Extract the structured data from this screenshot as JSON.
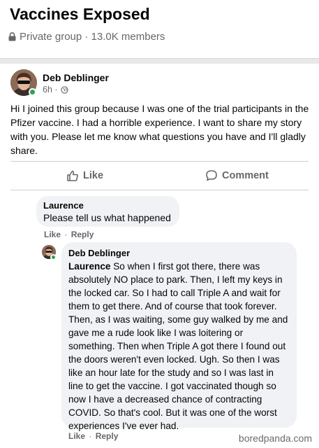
{
  "group": {
    "title": "Vaccines Exposed",
    "meta": "Private group · 13.0K members",
    "privacy_icon": "lock-icon"
  },
  "post": {
    "author": "Deb Deblinger",
    "time": "6h ·",
    "audience_icon": "globe-icon",
    "body": "Hi I joined this group because I was one of the trial participants in the Pfizer vaccine. I had a horrible experience. I want to share my story with you. Please let me know what questions you have and I'll gladly share.",
    "like_label": "Like",
    "comment_label": "Comment"
  },
  "comments": [
    {
      "author": "Laurence",
      "text": "Please tell us what happened",
      "like_label": "Like",
      "separator": "·",
      "reply_label": "Reply"
    },
    {
      "author": "Deb Deblinger",
      "mention": "Laurence",
      "text": " So when I first got there, there was absolutely NO place to park. Then, I left my keys in the locked car. So I had to call Triple A and wait for them to get there. And of course that took forever. Then, as I was waiting, some guy walked by me and gave me a rude look like I was loitering or something. Then when Triple A got there I found out the doors weren't even locked. Ugh. So then I was like an hour late for the study and so I was last in line to get the vaccine. I got vaccinated though so now I have a decreased chance of contracting COVID. So that's cool. But it was one of the worst experiences I've ever had.",
      "like_label": "Like",
      "separator": "·",
      "reply_label": "Reply"
    }
  ],
  "watermark": "boredpanda.com",
  "colors": {
    "online": "#31a24c",
    "secondary_text": "#65676b",
    "bubble": "#f0f2f5"
  }
}
